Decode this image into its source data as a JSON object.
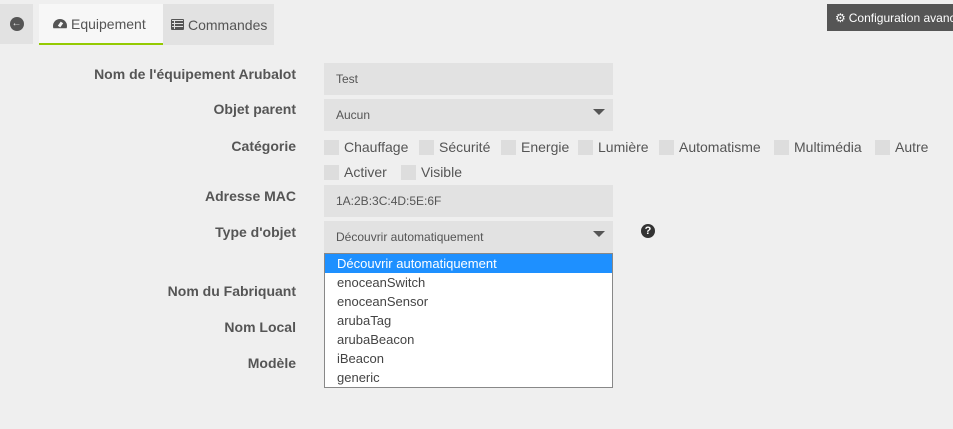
{
  "tabs": {
    "equipement": "Equipement",
    "commandes": "Commandes"
  },
  "config_button": "Configuration avancée",
  "form": {
    "nom_label": "Nom de l'équipement ArubaIot",
    "nom_value": "Test",
    "objet_label": "Objet parent",
    "objet_value": "Aucun",
    "categorie_label": "Catégorie",
    "categories": [
      "Chauffage",
      "Sécurité",
      "Energie",
      "Lumière",
      "Automatisme",
      "Multimédia",
      "Autre"
    ],
    "activer": "Activer",
    "visible": "Visible",
    "mac_label": "Adresse MAC",
    "mac_value": "1A:2B:3C:4D:5E:6F",
    "type_label": "Type d'objet",
    "type_value": "Découvrir automatiquement",
    "fabriquant_label": "Nom du Fabriquant",
    "local_label": "Nom Local",
    "modele_label": "Modèle"
  },
  "dropdown_options": [
    "Découvrir automatiquement",
    "enoceanSwitch",
    "enoceanSensor",
    "arubaTag",
    "arubaBeacon",
    "iBeacon",
    "generic"
  ],
  "colors": {
    "accent": "#94ca02",
    "selection": "#1e90ff"
  }
}
